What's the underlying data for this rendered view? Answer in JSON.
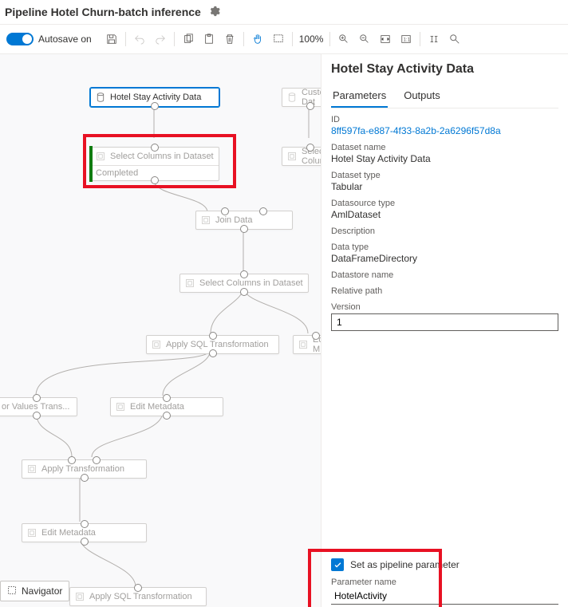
{
  "header": {
    "title": "Pipeline Hotel Churn-batch inference"
  },
  "toolbar": {
    "autosave": "Autosave on",
    "zoom": "100%"
  },
  "nodes": {
    "hotel_stay": "Hotel Stay Activity Data",
    "customer_data": "Customer Dat",
    "select_cols_1": "Select Columns in Dataset",
    "select_cols_1_status": "Completed",
    "select_cols_2": "Select Colum",
    "join": "Join Data",
    "select_cols_3": "Select Columns in Dataset",
    "apply_sql_1": "Apply SQL Transformation",
    "edit_m_right": "Edit M",
    "clip_values": "or Values Trans...",
    "edit_meta_1": "Edit Metadata",
    "apply_trans": "Apply Transformation",
    "edit_meta_2": "Edit Metadata",
    "apply_sql_2": "Apply SQL Transformation"
  },
  "navigator": "Navigator",
  "panel": {
    "title": "Hotel Stay Activity Data",
    "tabs": {
      "parameters": "Parameters",
      "outputs": "Outputs"
    },
    "id_label": "ID",
    "id_value": "8ff597fa-e887-4f33-8a2b-2a6296f57d8a",
    "ds_name_label": "Dataset name",
    "ds_name_value": "Hotel Stay Activity Data",
    "ds_type_label": "Dataset type",
    "ds_type_value": "Tabular",
    "src_type_label": "Datasource type",
    "src_type_value": "AmlDataset",
    "desc_label": "Description",
    "data_type_label": "Data type",
    "data_type_value": "DataFrameDirectory",
    "store_label": "Datastore name",
    "relpath_label": "Relative path",
    "version_label": "Version",
    "version_value": "1",
    "set_param_label": "Set as pipeline parameter",
    "param_name_label": "Parameter name",
    "param_name_value": "HotelActivity"
  }
}
